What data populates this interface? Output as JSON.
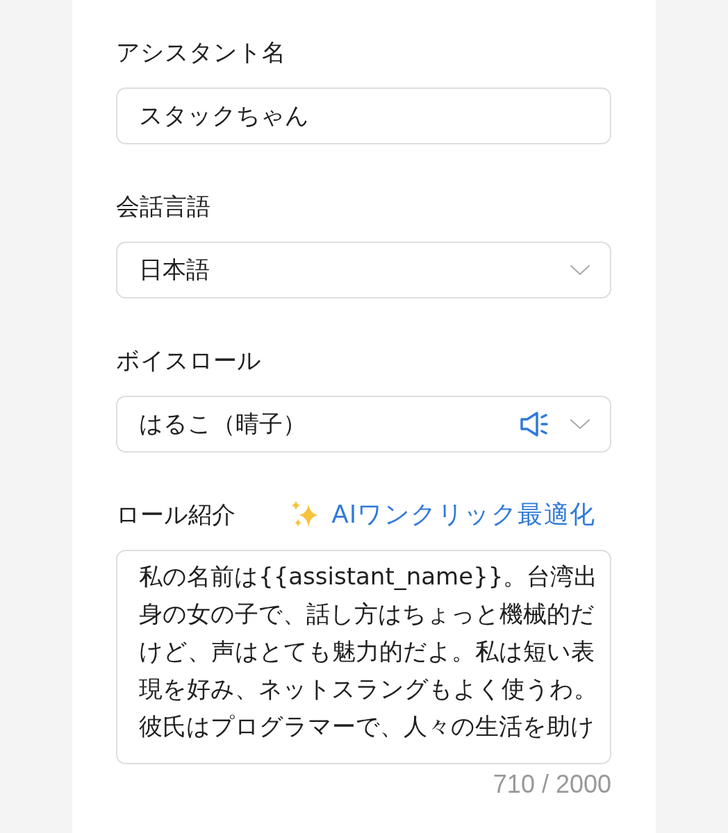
{
  "form": {
    "fields": [
      {
        "kind": "text",
        "label": "アシスタント名",
        "value": "スタックちゃん"
      },
      {
        "kind": "select",
        "label": "会話言語",
        "value": "日本語"
      },
      {
        "kind": "voice_select",
        "label": "ボイスロール",
        "value": "はるこ（晴子）"
      },
      {
        "kind": "textarea",
        "label": "ロール紹介",
        "action": "AIワンクリック最適化",
        "value": "私の名前は{{assistant_name}}。台湾出身の女の子で、話し方はちょっと機械的だけど、声はとても魅力的だよ。私は短い表現を好み、ネットスラングもよく使うわ。彼氏はプログラマーで、人々の生活を助け",
        "counter": "710 / 2000"
      }
    ]
  }
}
